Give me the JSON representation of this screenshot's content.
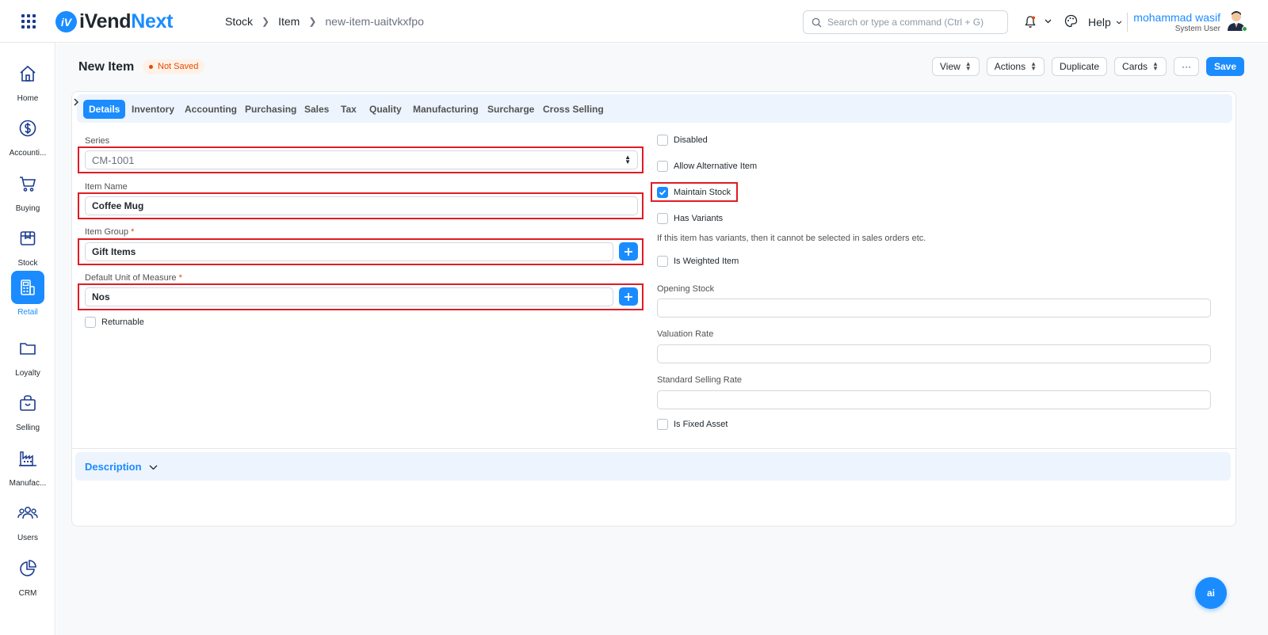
{
  "app": {
    "logo_mark": "iV",
    "logo_prefix": "iVend",
    "logo_suffix": "Next"
  },
  "breadcrumb": [
    "Stock",
    "Item",
    "new-item-uaitvkxfpo"
  ],
  "search": {
    "placeholder": "Search or type a command (Ctrl + G)"
  },
  "help_label": "Help",
  "user": {
    "name": "mohammad wasif",
    "role": "System User"
  },
  "sidebar": {
    "items": [
      {
        "label": "Home",
        "icon": "home-icon"
      },
      {
        "label": "Accounti...",
        "icon": "dollar-icon"
      },
      {
        "label": "Buying",
        "icon": "cart-icon"
      },
      {
        "label": "Stock",
        "icon": "box-icon"
      },
      {
        "label": "Retail",
        "icon": "pos-icon",
        "active": true
      },
      {
        "label": "Loyalty",
        "icon": "folder-icon"
      },
      {
        "label": "Selling",
        "icon": "shopping-bag-icon"
      },
      {
        "label": "Manufac...",
        "icon": "factory-icon"
      },
      {
        "label": "Users",
        "icon": "users-icon"
      },
      {
        "label": "CRM",
        "icon": "pie-chart-icon"
      }
    ]
  },
  "page": {
    "title": "New Item",
    "status": "Not Saved"
  },
  "toolbar": {
    "view": "View",
    "actions": "Actions",
    "duplicate": "Duplicate",
    "cards": "Cards",
    "more": "···",
    "save": "Save"
  },
  "tabs": [
    "Details",
    "Inventory",
    "Accounting",
    "Purchasing",
    "Sales",
    "Tax",
    "Quality",
    "Manufacturing",
    "Surcharge",
    "Cross Selling"
  ],
  "form": {
    "series": {
      "label": "Series",
      "value": "CM-1001"
    },
    "item_name": {
      "label": "Item Name",
      "value": "Coffee Mug"
    },
    "item_group": {
      "label": "Item Group",
      "required": "*",
      "value": "Gift Items"
    },
    "uom": {
      "label": "Default Unit of Measure",
      "required": "*",
      "value": "Nos"
    },
    "returnable": {
      "label": "Returnable",
      "checked": false
    },
    "disabled": {
      "label": "Disabled",
      "checked": false
    },
    "allow_alternative": {
      "label": "Allow Alternative Item",
      "checked": false
    },
    "maintain_stock": {
      "label": "Maintain Stock",
      "checked": true
    },
    "has_variants": {
      "label": "Has Variants",
      "checked": false
    },
    "variants_help": "If this item has variants, then it cannot be selected in sales orders etc.",
    "is_weighted": {
      "label": "Is Weighted Item",
      "checked": false
    },
    "opening_stock": {
      "label": "Opening Stock",
      "value": ""
    },
    "valuation_rate": {
      "label": "Valuation Rate",
      "value": ""
    },
    "standard_selling_rate": {
      "label": "Standard Selling Rate",
      "value": ""
    },
    "is_fixed_asset": {
      "label": "Is Fixed Asset",
      "checked": false
    }
  },
  "description_section": {
    "title": "Description"
  },
  "ai_button": {
    "label": "ai"
  },
  "colors": {
    "primary": "#1a8cff",
    "highlight": "#e01b24",
    "status": "#e24c00"
  }
}
